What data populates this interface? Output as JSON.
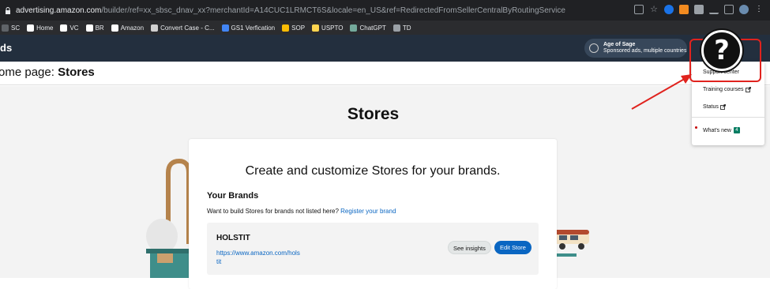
{
  "browser": {
    "url_host": "advertising.amazon.com",
    "url_path": "/builder/ref=xx_sbsc_dnav_xx?merchantId=A14CUC1LRMCT6S&locale=en_US&ref=RedirectedFromSellerCentralByRoutingService"
  },
  "bookmarks": [
    {
      "label": "SC",
      "icon": "sc-icon",
      "color": "#5f6368"
    },
    {
      "label": "Home",
      "icon": "amazon-icon",
      "color": "#ffffff"
    },
    {
      "label": "VC",
      "icon": "amazon-icon",
      "color": "#ffffff"
    },
    {
      "label": "BR",
      "icon": "amazon-icon",
      "color": "#ffffff"
    },
    {
      "label": "Amazon",
      "icon": "amazon-icon",
      "color": "#ffffff"
    },
    {
      "label": "Convert Case - C...",
      "icon": "cc-icon",
      "color": "#d0d0d0"
    },
    {
      "label": "GS1 Verfication",
      "icon": "arrow-icon",
      "color": "#4285f4"
    },
    {
      "label": "SOP",
      "icon": "bars-icon",
      "color": "#fbbc04"
    },
    {
      "label": "USPTO",
      "icon": "eagle-icon",
      "color": "#ffd54f"
    },
    {
      "label": "ChatGPT",
      "icon": "chatgpt-icon",
      "color": "#74aa9c"
    },
    {
      "label": "TD",
      "icon": "td-icon",
      "color": "#9aa0a6"
    }
  ],
  "header": {
    "brand_fragment": "ds",
    "account_name": "Age of Sage",
    "account_sub": "Sponsored ads, multiple countries"
  },
  "title": {
    "prefix": "ome page:",
    "page": "Stores"
  },
  "main": {
    "heading": "Stores",
    "card_title": "Create and customize Stores for your brands.",
    "your_brands": "Your Brands",
    "want_text": "Want to build Stores for brands not listed here?",
    "register_link": "Register your brand",
    "brand": {
      "name": "HOLSTIT",
      "url": "https://www.amazon.com/holstit",
      "insights_label": "See insights",
      "edit_label": "Edit Store"
    }
  },
  "dropdown": {
    "items": [
      "Support center",
      "Training courses",
      "Status",
      "What's new"
    ],
    "new_badge": "4"
  },
  "colors": {
    "header_bg": "#232f3e",
    "accent_blue": "#0a66c2",
    "annotation_red": "#e0231e"
  }
}
